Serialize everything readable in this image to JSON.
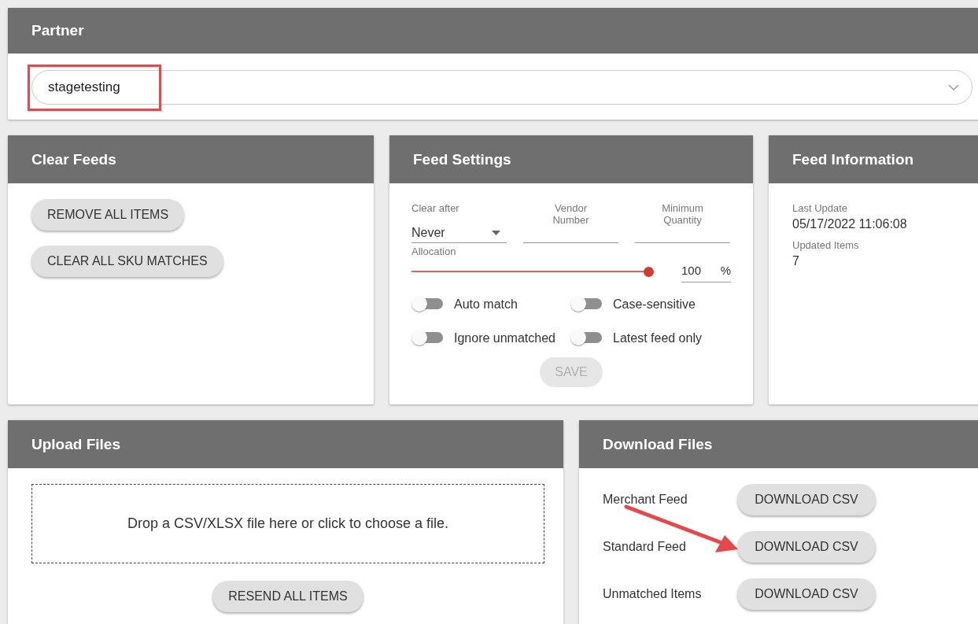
{
  "partner": {
    "title": "Partner",
    "value": "stagetesting"
  },
  "clear_feeds": {
    "title": "Clear Feeds",
    "buttons": [
      "REMOVE ALL ITEMS",
      "CLEAR ALL SKU MATCHES"
    ]
  },
  "feed_settings": {
    "title": "Feed Settings",
    "fields": [
      {
        "kind": "select",
        "label": "Clear after",
        "value": "Never"
      },
      {
        "kind": "text",
        "label": "Vendor Number"
      },
      {
        "kind": "text",
        "label": "Minimum Quantity"
      }
    ],
    "allocation": {
      "label": "Allocation",
      "level": 1,
      "value": "100",
      "unit": "%"
    },
    "toggles": [
      {
        "label": "Auto match",
        "on": false
      },
      {
        "label": "Case-sensitive",
        "on": false
      },
      {
        "label": "Ignore unmatched",
        "on": false
      },
      {
        "label": "Latest feed only",
        "on": false
      }
    ],
    "save": {
      "label": "SAVE",
      "disabled": true
    }
  },
  "feed_information": {
    "title": "Feed Information",
    "items": [
      {
        "label": "Last Update",
        "value": "05/17/2022 11:06:08"
      },
      {
        "label": "Updated Items",
        "value": "7"
      }
    ]
  },
  "upload_files": {
    "title": "Upload Files",
    "dropzone": "Drop a CSV/XLSX file here or click to choose a file.",
    "button": "RESEND ALL ITEMS"
  },
  "download_files": {
    "title": "Download Files",
    "rows": [
      {
        "label": "Merchant Feed",
        "button": "DOWNLOAD CSV"
      },
      {
        "label": "Standard Feed",
        "button": "DOWNLOAD CSV"
      },
      {
        "label": "Unmatched Items",
        "button": "DOWNLOAD CSV"
      }
    ]
  }
}
